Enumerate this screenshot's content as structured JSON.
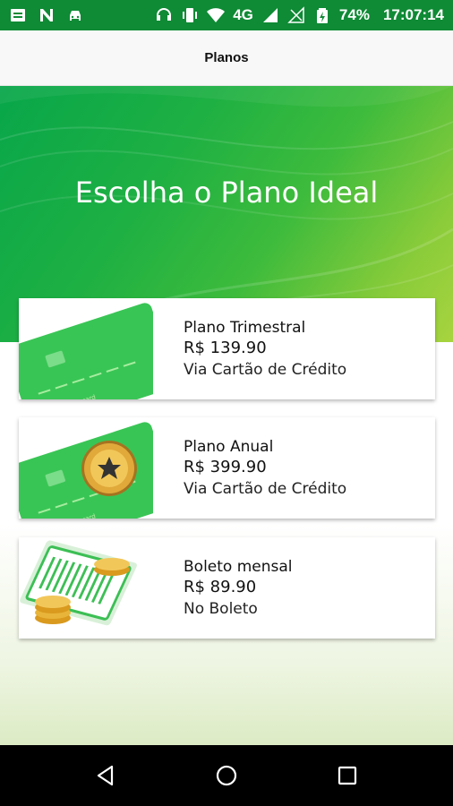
{
  "status_bar": {
    "left_icons": [
      "notification-icon",
      "n-app-icon",
      "car-icon"
    ],
    "battery": "74%",
    "time": "17:07:14",
    "network": "4G"
  },
  "toolbar": {
    "title": "Planos"
  },
  "hero": {
    "title": "Escolha o Plano Ideal"
  },
  "plans": [
    {
      "name": "Plano Trimestral",
      "price": "R$ 139.90",
      "method": "Via Cartão de Crédito",
      "image": "green-credit-card"
    },
    {
      "name": "Plano Anual",
      "price": "R$ 399.90",
      "method": "Via Cartão de Crédito",
      "image": "credit-card-with-gold-medal"
    },
    {
      "name": "Boleto mensal",
      "price": "R$ 89.90",
      "method": "No Boleto",
      "image": "boleto-with-coins"
    }
  ],
  "colors": {
    "brand_green": "#0f8a35",
    "hero_start": "#08a64a",
    "hero_end": "#a7d43f"
  },
  "navbar": {
    "buttons": [
      "back-icon",
      "home-icon",
      "recents-icon"
    ]
  }
}
